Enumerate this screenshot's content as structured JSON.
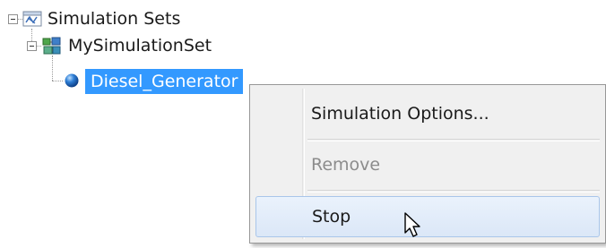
{
  "tree": {
    "root": {
      "label": "Simulation Sets",
      "icon": "simulation-sets-icon"
    },
    "set": {
      "label": "MySimulationSet",
      "icon": "simulation-set-icon"
    },
    "item": {
      "label": "Diesel_Generator",
      "icon": "blue-sphere-icon"
    }
  },
  "context_menu": {
    "items": [
      {
        "label": "Simulation Options...",
        "enabled": true
      },
      {
        "label": "Remove",
        "enabled": false
      },
      {
        "label": "Stop",
        "enabled": true,
        "hovered": true
      }
    ]
  },
  "colors": {
    "selection": "#3399ff",
    "menu_background": "#f0f0f0",
    "hover_border": "#a9c6ea"
  }
}
